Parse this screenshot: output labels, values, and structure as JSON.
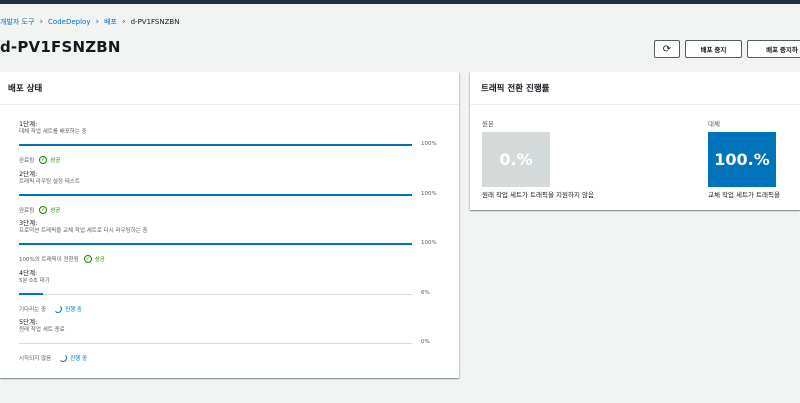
{
  "breadcrumb": {
    "items": [
      "개발자 도구",
      "CodeDeploy",
      "배포"
    ],
    "current": "d-PV1FSNZBN"
  },
  "page": {
    "title": "d-PV1FSNZBN"
  },
  "actions": {
    "refresh_icon": "refresh-icon",
    "stop_label": "배포 중지",
    "stop_rollback_label": "배포 중지하"
  },
  "status_panel": {
    "title": "배포 상태",
    "steps": [
      {
        "title": "1단계:",
        "desc": "대체 작업 세트를 배포하는 중",
        "progress": 1.0,
        "percent": "100%",
        "state": "완료됨",
        "result": "성공",
        "result_type": "success"
      },
      {
        "title": "2단계:",
        "desc": "트래픽 라우팅 설정 테스트",
        "progress": 1.0,
        "percent": "100%",
        "state": "완료됨",
        "result": "성공",
        "result_type": "success"
      },
      {
        "title": "3단계:",
        "desc": "프로덕션 트래픽을 교체 작업 세트로 다시 라우팅하는 중",
        "progress": 1.0,
        "percent": "100%",
        "state": "100%의 트래픽이 전환됨",
        "result": "성공",
        "result_type": "success"
      },
      {
        "title": "4단계:",
        "desc": "5분 0초 대기",
        "progress": 0.06,
        "percent": "6%",
        "state": "기다리는 중",
        "result": "진행 중",
        "result_type": "progress"
      },
      {
        "title": "5단계:",
        "desc": "원래 작업 세트 종료",
        "progress": 0.0,
        "percent": "0%",
        "state": "시작되지 않음",
        "result": "진행 중",
        "result_type": "progress"
      }
    ]
  },
  "traffic_panel": {
    "title": "트래픽 전환 진행률",
    "original": {
      "label": "원본",
      "value": "0.%",
      "note": "원래 작업 세트가 트래픽을 지원하지 않음",
      "color": "#d5dbdb"
    },
    "replacement": {
      "label": "대체",
      "value": "100.%",
      "note": "교체 작업 세트가 트래픽을",
      "color": "#0073bb"
    }
  },
  "colors": {
    "accent": "#0073bb",
    "success": "#1d8102",
    "topbar": "#232f3e"
  }
}
